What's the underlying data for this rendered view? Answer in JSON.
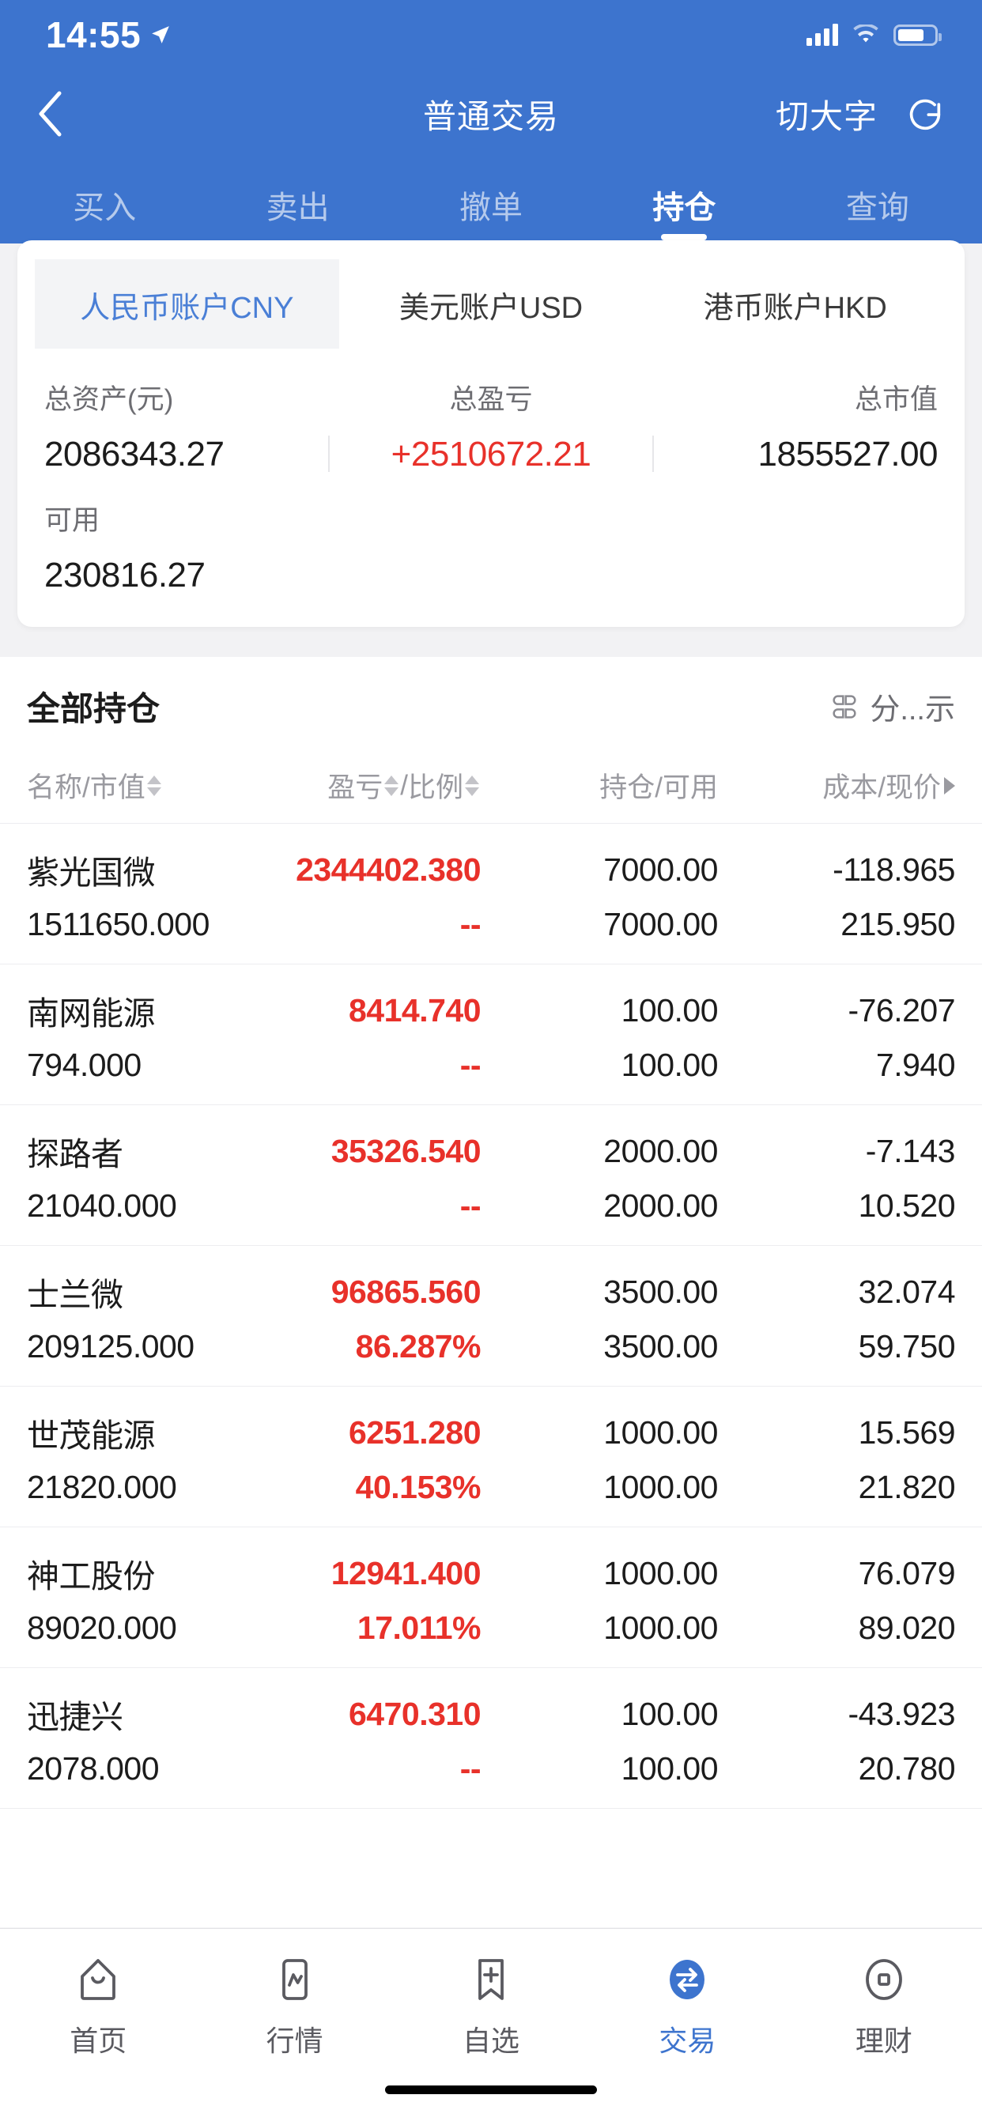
{
  "status_bar": {
    "time": "14:55",
    "location_icon": "location-arrow-icon",
    "signal_icon": "cellular-signal-icon",
    "wifi_icon": "wifi-icon",
    "battery_icon": "battery-icon"
  },
  "nav": {
    "back_icon": "chevron-left-icon",
    "title": "普通交易",
    "big_font_label": "切大字",
    "refresh_icon": "refresh-icon"
  },
  "trade_tabs": [
    {
      "label": "买入",
      "active": false
    },
    {
      "label": "卖出",
      "active": false
    },
    {
      "label": "撤单",
      "active": false
    },
    {
      "label": "持仓",
      "active": true
    },
    {
      "label": "查询",
      "active": false
    }
  ],
  "account_tabs": [
    {
      "label": "人民币账户CNY",
      "active": true
    },
    {
      "label": "美元账户USD",
      "active": false
    },
    {
      "label": "港币账户HKD",
      "active": false
    }
  ],
  "totals": {
    "total_assets_label": "总资产(元)",
    "total_assets_value": "2086343.27",
    "total_pnl_label": "总盈亏",
    "total_pnl_value": "+2510672.21",
    "total_market_value_label": "总市值",
    "total_market_value": "1855527.00",
    "available_label": "可用",
    "available_value": "230816.27"
  },
  "holdings": {
    "section_title": "全部持仓",
    "display_toggle_label": "分...示",
    "display_toggle_icon": "grid-layout-icon",
    "columns": {
      "c1": "名称/市值",
      "c2_a": "盈亏",
      "c2_sep": "/",
      "c2_b": "比例",
      "c3": "持仓/可用",
      "c4": "成本/现价"
    },
    "rows": [
      {
        "name": "紫光国微",
        "market_value": "1511650.000",
        "pnl": "2344402.380",
        "pnl_ratio": "--",
        "position": "7000.00",
        "available": "7000.00",
        "cost": "-118.965",
        "price": "215.950"
      },
      {
        "name": "南网能源",
        "market_value": "794.000",
        "pnl": "8414.740",
        "pnl_ratio": "--",
        "position": "100.00",
        "available": "100.00",
        "cost": "-76.207",
        "price": "7.940"
      },
      {
        "name": "探路者",
        "market_value": "21040.000",
        "pnl": "35326.540",
        "pnl_ratio": "--",
        "position": "2000.00",
        "available": "2000.00",
        "cost": "-7.143",
        "price": "10.520"
      },
      {
        "name": "士兰微",
        "market_value": "209125.000",
        "pnl": "96865.560",
        "pnl_ratio": "86.287%",
        "position": "3500.00",
        "available": "3500.00",
        "cost": "32.074",
        "price": "59.750"
      },
      {
        "name": "世茂能源",
        "market_value": "21820.000",
        "pnl": "6251.280",
        "pnl_ratio": "40.153%",
        "position": "1000.00",
        "available": "1000.00",
        "cost": "15.569",
        "price": "21.820"
      },
      {
        "name": "神工股份",
        "market_value": "89020.000",
        "pnl": "12941.400",
        "pnl_ratio": "17.011%",
        "position": "1000.00",
        "available": "1000.00",
        "cost": "76.079",
        "price": "89.020"
      },
      {
        "name": "迅捷兴",
        "market_value": "2078.000",
        "pnl": "6470.310",
        "pnl_ratio": "--",
        "position": "100.00",
        "available": "100.00",
        "cost": "-43.923",
        "price": "20.780"
      }
    ]
  },
  "bottom_nav": [
    {
      "label": "首页",
      "icon": "home-icon",
      "active": false
    },
    {
      "label": "行情",
      "icon": "market-chart-icon",
      "active": false
    },
    {
      "label": "自选",
      "icon": "bookmark-plus-icon",
      "active": false
    },
    {
      "label": "交易",
      "icon": "exchange-arrows-icon",
      "active": true
    },
    {
      "label": "理财",
      "icon": "wallet-icon",
      "active": false
    }
  ],
  "colors": {
    "header_blue": "#3d74ce",
    "accent_blue": "#4a7fd6",
    "gain_red": "#e8312a",
    "page_bg": "#f2f2f4",
    "text_primary": "#1c1c1c",
    "text_muted": "#6d6d72"
  }
}
